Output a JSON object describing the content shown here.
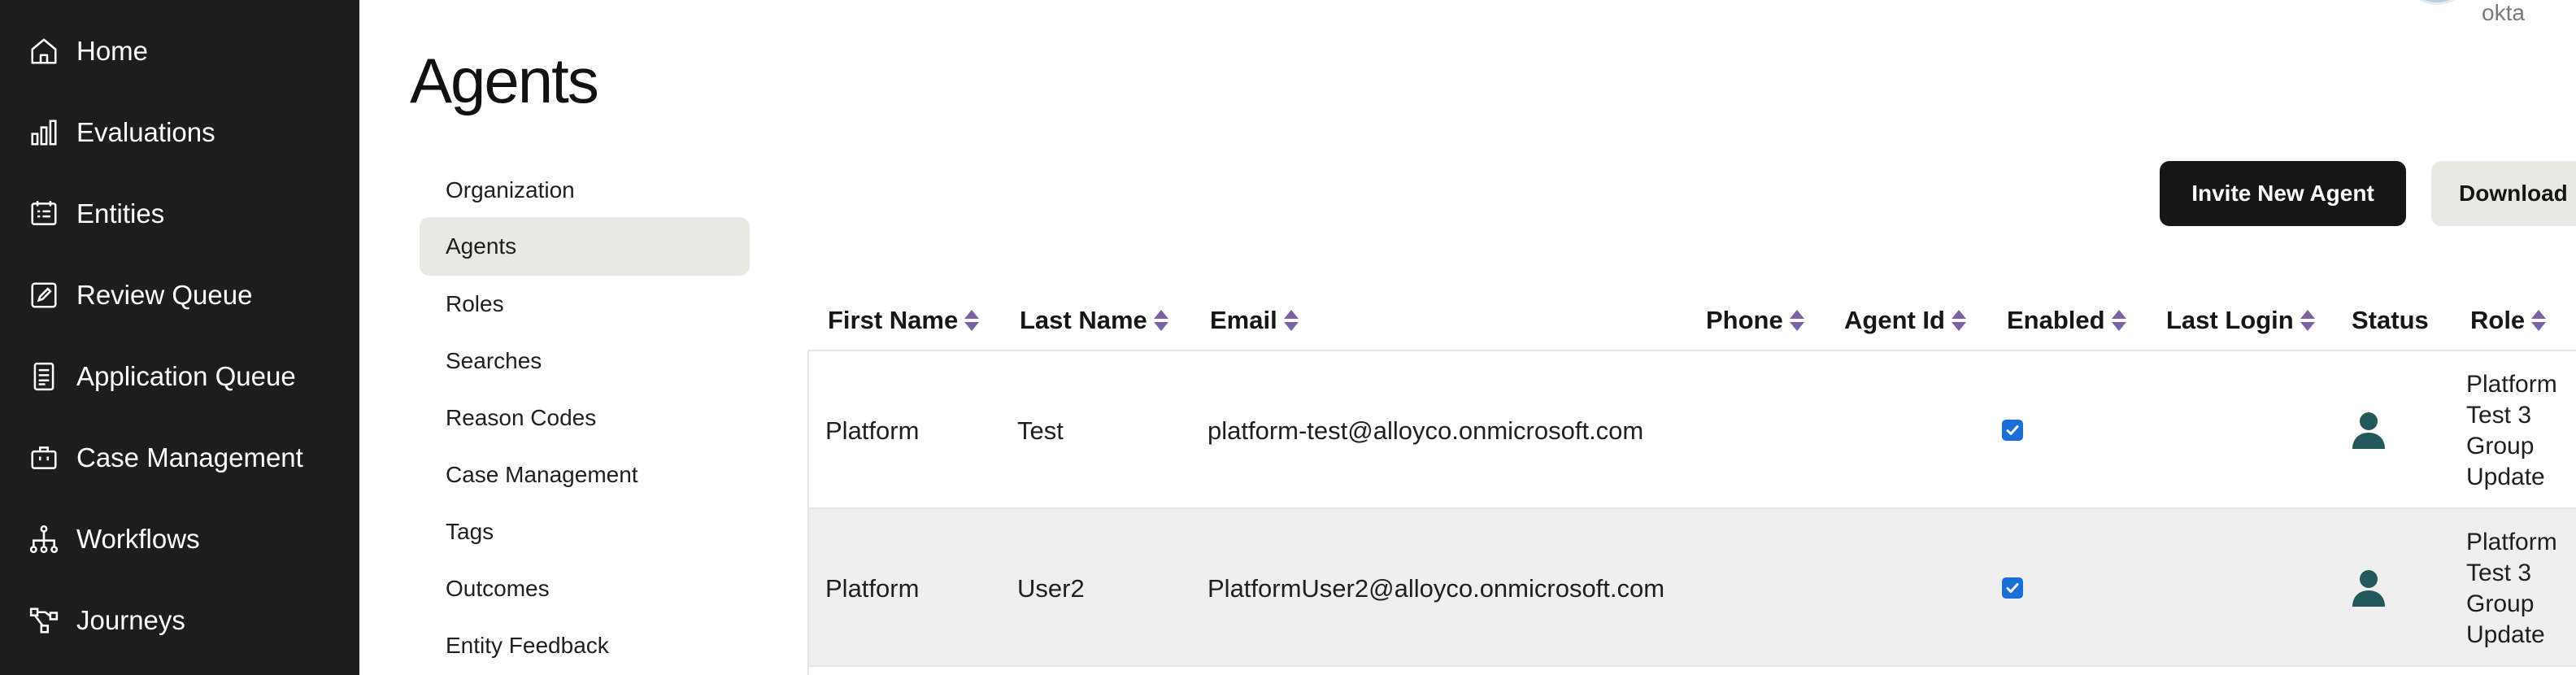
{
  "sidebar": {
    "items": [
      {
        "label": "Home",
        "icon": "home-icon"
      },
      {
        "label": "Evaluations",
        "icon": "bar-chart-icon"
      },
      {
        "label": "Entities",
        "icon": "list-card-icon"
      },
      {
        "label": "Review Queue",
        "icon": "edit-icon"
      },
      {
        "label": "Application Queue",
        "icon": "document-icon"
      },
      {
        "label": "Case Management",
        "icon": "briefcase-icon"
      },
      {
        "label": "Workflows",
        "icon": "workflow-icon"
      },
      {
        "label": "Journeys",
        "icon": "journey-icon"
      }
    ]
  },
  "header": {
    "org_name": "okta",
    "title": "Agents"
  },
  "subnav": {
    "items": [
      {
        "label": "Organization",
        "active": false
      },
      {
        "label": "Agents",
        "active": true
      },
      {
        "label": "Roles",
        "active": false
      },
      {
        "label": "Searches",
        "active": false
      },
      {
        "label": "Reason Codes",
        "active": false
      },
      {
        "label": "Case Management",
        "active": false
      },
      {
        "label": "Tags",
        "active": false
      },
      {
        "label": "Outcomes",
        "active": false
      },
      {
        "label": "Entity Feedback",
        "active": false
      }
    ]
  },
  "actions": {
    "invite_label": "Invite New Agent",
    "download_label": "Download"
  },
  "table": {
    "columns": [
      "First Name",
      "Last Name",
      "Email",
      "Phone",
      "Agent Id",
      "Enabled",
      "Last Login",
      "Status",
      "Role"
    ],
    "rows": [
      {
        "first_name": "Platform",
        "last_name": "Test",
        "email": "platform-test@alloyco.onmicrosoft.com",
        "phone": "",
        "agent_id": "",
        "enabled": true,
        "last_login": "",
        "status": "user-icon",
        "role": "Platform Test 3 Group Update"
      },
      {
        "first_name": "Platform",
        "last_name": "User2",
        "email": "PlatformUser2@alloyco.onmicrosoft.com",
        "phone": "",
        "agent_id": "",
        "enabled": true,
        "last_login": "",
        "status": "user-icon",
        "role": "Platform Test 3 Group Update"
      }
    ]
  },
  "colors": {
    "sidebar_bg": "#1d1d1d",
    "accent_sort": "#7b63a3",
    "status_icon": "#23595a",
    "checkbox": "#1a6fd6"
  }
}
